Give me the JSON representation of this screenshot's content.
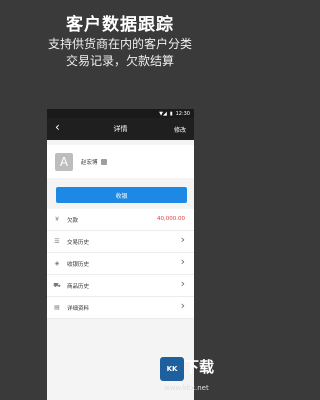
{
  "promo": {
    "title": "客户数据跟踪",
    "subtitle_line1": "支持供货商在内的客户分类",
    "subtitle_line2": "交易记录，欠款结算"
  },
  "status_bar": {
    "time": "12:30"
  },
  "navbar": {
    "back_icon": "chevron-left-icon",
    "title": "详情",
    "edit_label": "修改"
  },
  "profile": {
    "avatar_letter": "A",
    "name": "赵宏博",
    "badge_icon": "tag-icon"
  },
  "cash_button": {
    "label": "收银"
  },
  "list": [
    {
      "icon": "yen-icon",
      "label": "欠款",
      "value": "40,000.00",
      "has_arrow": false
    },
    {
      "icon": "list-icon",
      "label": "交易历史",
      "has_arrow": true
    },
    {
      "icon": "money-icon",
      "label": "收银历史",
      "has_arrow": true
    },
    {
      "icon": "cart-icon",
      "label": "商品历史",
      "has_arrow": true
    },
    {
      "icon": "document-icon",
      "label": "详细资料",
      "has_arrow": true
    }
  ],
  "watermark": {
    "logo_text": "KK",
    "text": "下载",
    "url": "www.kkx.net"
  },
  "colors": {
    "accent": "#1e88e5",
    "debt": "#e53935",
    "background": "#3a3a3a"
  }
}
